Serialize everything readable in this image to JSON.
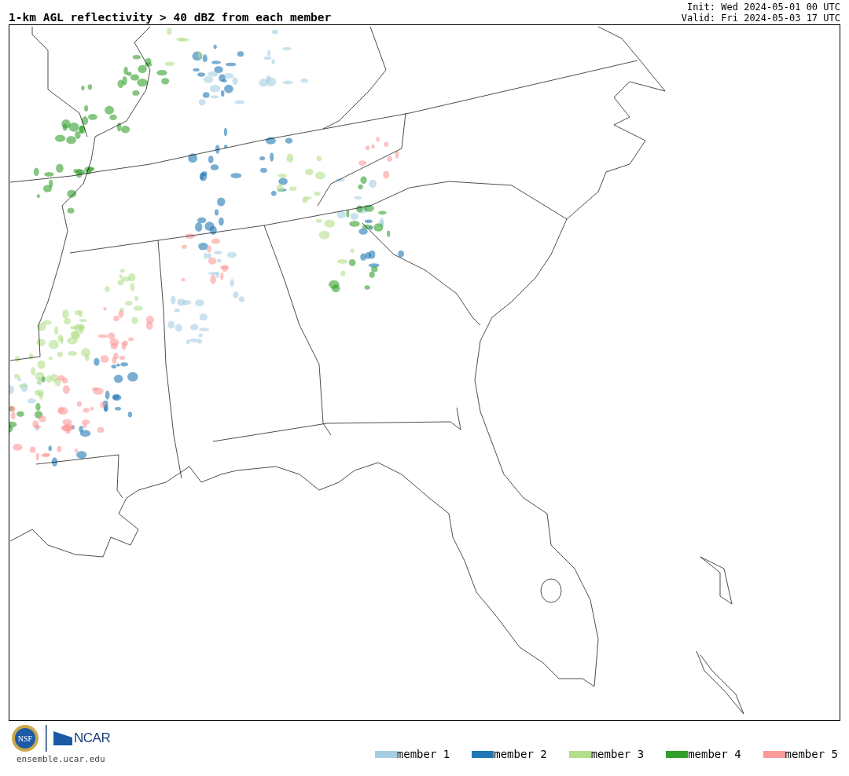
{
  "title": "1-km AGL reflectivity > 40 dBZ from each member",
  "init": "Init: Wed 2024-05-01 00 UTC",
  "valid": "Valid: Fri 2024-05-03 17 UTC",
  "logos": {
    "nsf": "NSF",
    "ncar": "NCAR"
  },
  "site": "ensemble.ucar.edu",
  "members": [
    {
      "name": "member 1",
      "color": "#a6cee3"
    },
    {
      "name": "member 2",
      "color": "#1f78b4"
    },
    {
      "name": "member 3",
      "color": "#b2df8a"
    },
    {
      "name": "member 4",
      "color": "#33a02c"
    },
    {
      "name": "member 5",
      "color": "#fb9a99"
    }
  ]
}
